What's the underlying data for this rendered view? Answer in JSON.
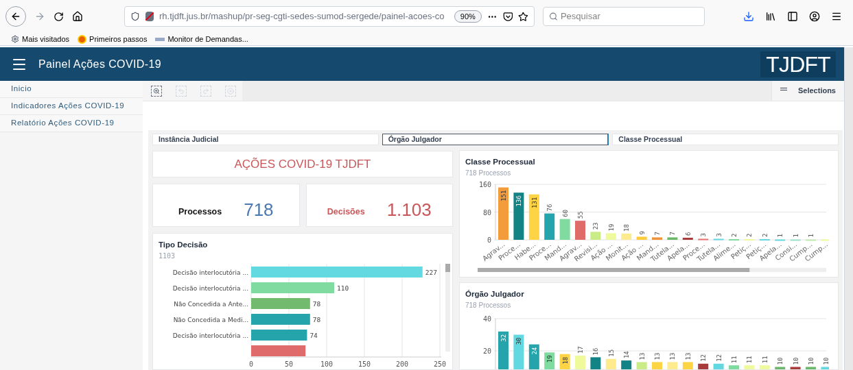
{
  "browser": {
    "url": "rh.tjdft.jus.br/mashup/pr-seg-cgti-sedes-sumod-sergede/painel-acoes-co",
    "zoom": "90%",
    "search_placeholder": "Pesquisar",
    "bookmarks": [
      "Mais visitados",
      "Primeiros passos",
      "Monitor de Demandas..."
    ]
  },
  "header": {
    "title": "Painel Ações COVID-19",
    "logo": "TJDFT"
  },
  "sidebar": {
    "items": [
      {
        "label": "Inicio",
        "selected": false
      },
      {
        "label": "Indicadores Ações COVID-19",
        "selected": false
      },
      {
        "label": "Relatório Ações COVID-19",
        "selected": false
      }
    ]
  },
  "toolbar": {
    "tools": [
      {
        "kind": "search",
        "disabled": false
      },
      {
        "kind": "back",
        "disabled": true
      },
      {
        "kind": "forward",
        "disabled": true
      },
      {
        "kind": "clear",
        "disabled": true
      }
    ],
    "selections": "Selections"
  },
  "filters": [
    {
      "label": "Instância Judicial",
      "selected": false
    },
    {
      "label": "Órgão Julgador",
      "selected": true
    },
    {
      "label": "Classe Processual",
      "selected": false
    }
  ],
  "title_card": "AÇÕES COVID-19 TJDFT",
  "kpis": [
    {
      "label": "Processos",
      "value": "718",
      "color": "#4a78b0"
    },
    {
      "label": "Decisões",
      "value": "1.103",
      "color": "#c9575a"
    }
  ],
  "tipo_decisao": {
    "title": "Tipo Decisão",
    "subtitle": "1103",
    "chart_data": {
      "type": "bar",
      "orientation": "horizontal",
      "categories": [
        "Decisão interlocutória ...",
        "Decisão interlocutória ...",
        "Não Concedida a Ante...",
        "Não Concedida a Medi...",
        "Decisão interlocutória ...",
        null
      ],
      "values": [
        227,
        110,
        78,
        78,
        74,
        72
      ],
      "colors": [
        "#62d8e0",
        "#7fdba0",
        "#72bb6e",
        "#26a4ac",
        "#26a4ac",
        "#e06b6b"
      ],
      "value_labels": [
        "227",
        "110",
        "78",
        "78",
        "74",
        null
      ],
      "xlim": [
        0,
        250
      ],
      "xticks": [
        0,
        50,
        100,
        150,
        200,
        250
      ],
      "grid": true
    }
  },
  "classe_processual": {
    "title": "Classe Processual",
    "subtitle": "718 Processos",
    "chart_data": {
      "type": "bar",
      "categories": [
        "Agrav...",
        "Proce...",
        "Habe...",
        "Proce...",
        "Mand...",
        "Agrav...",
        "Revisi...",
        "Ação ...",
        "Monit...",
        "Ação ...",
        "Mand...",
        "Tutela...",
        "Apela...",
        "Proce...",
        "Tutela...",
        "Alime...",
        "Petiç...",
        "Petiç...",
        "Apela...",
        "Consi...",
        "Cump...",
        "Cump..."
      ],
      "values": [
        151,
        136,
        131,
        76,
        60,
        55,
        23,
        19,
        18,
        9,
        7,
        7,
        6,
        3,
        3,
        2,
        2,
        2,
        1,
        1,
        1,
        1
      ],
      "colors": [
        "#f39c3c",
        "#148386",
        "#ffd444",
        "#26a4ac",
        "#7fdba0",
        "#e06b6b",
        "#c9ec86",
        "#eefa9c",
        "#fdeb8d",
        "#fdcc3a",
        "#f0943b",
        "#6cb86a",
        "#a83b3b",
        "#e87070",
        "#62d8e0",
        "#7fdba0",
        "#eefa9c",
        "#62d8e0",
        "#62d8e0",
        "#9fe0c8",
        "#c0eab0",
        "#eefa9c"
      ],
      "value_labels": [
        "151",
        "136",
        "131",
        "76",
        "60",
        "55",
        "23",
        "19",
        "18",
        "9",
        "7",
        "7",
        "6",
        "3",
        "3",
        "2",
        "2",
        "2",
        "1",
        "1",
        "1",
        null
      ],
      "ylim": [
        0,
        160
      ],
      "yticks": [
        0,
        80,
        160
      ]
    }
  },
  "orgao_julgador": {
    "title": "Órgão Julgador",
    "subtitle": "718 Processos",
    "chart_data": {
      "type": "bar",
      "values": [
        32,
        30,
        24,
        19,
        18,
        17,
        16,
        15,
        14,
        13,
        13,
        13,
        13,
        12,
        12,
        11,
        11,
        11,
        10,
        10,
        10,
        10
      ],
      "colors": [
        "#26a4ac",
        "#62d8e0",
        "#26a4ac",
        "#7fdba0",
        "#fdd444",
        "#eefa9c",
        "#148386",
        "#fdeb8d",
        "#148386",
        "#c9ec86",
        "#fdd444",
        "#fdeb8d",
        "#fdd444",
        "#a83b3b",
        "#62d8e0",
        "#7fdba0",
        "#eefa9c",
        "#eefa9c",
        "#6cb86a",
        "#a83b3b",
        "#6cb86a",
        "#62d8e0"
      ],
      "data_labels": true,
      "ylim": [
        0,
        40
      ],
      "yticks": [
        20,
        40
      ]
    }
  }
}
